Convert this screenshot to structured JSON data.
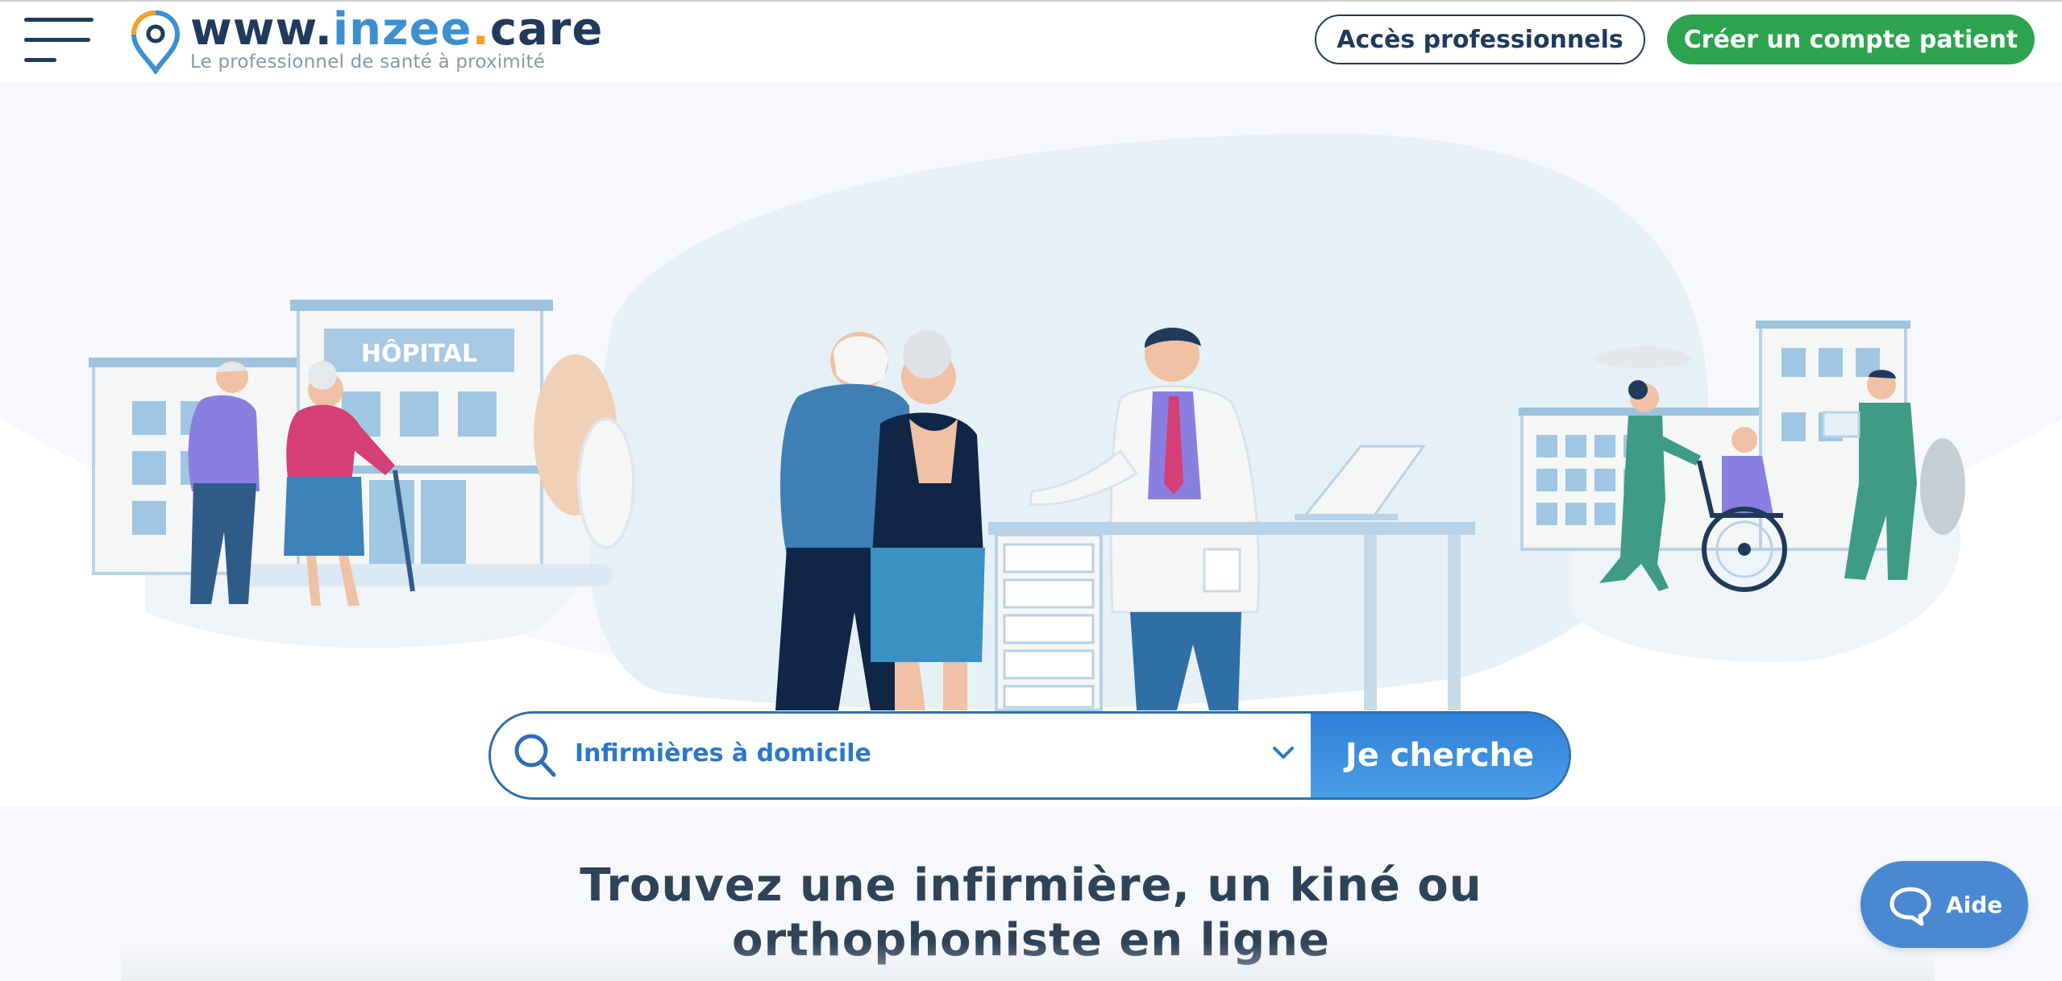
{
  "header": {
    "logo": {
      "www": "www.",
      "brand": "inzee",
      "dot": ".",
      "tld": "care",
      "tagline": "Le professionnel de santé à proximité"
    },
    "pro_button": "Accès professionnels",
    "patient_button": "Créer un compte patient"
  },
  "hero": {
    "hospital_sign": "HÔPITAL"
  },
  "search": {
    "selected_value": "Infirmières à domicile",
    "button_label": "Je cherche"
  },
  "tagline": {
    "line1": "Trouvez une infirmière, un kiné ou",
    "line2": "orthophoniste en ligne"
  },
  "help": {
    "label": "Aide"
  },
  "colors": {
    "navy": "#1f3a5a",
    "brand_blue": "#3d8fd0",
    "accent_orange": "#f2a22b",
    "green": "#2da34f",
    "search_blue": "#2d80d7"
  },
  "icons": [
    "menu-icon",
    "location-pin-icon",
    "search-icon",
    "chevron-down-icon",
    "chat-bubble-icon"
  ]
}
